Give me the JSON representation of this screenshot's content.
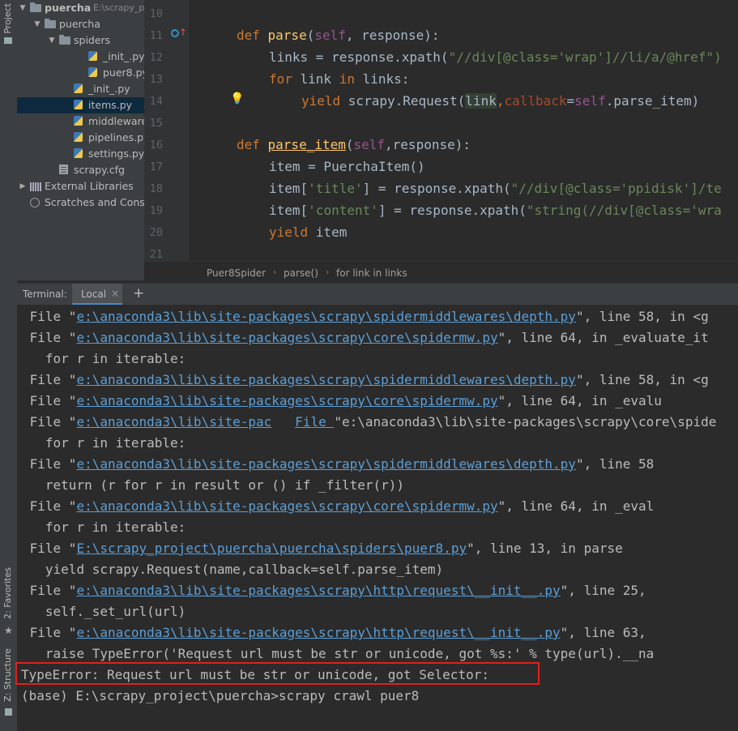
{
  "left_strip": {
    "project_tab": "1: Project",
    "favorites_tab": "2: Favorites",
    "structure_tab": "Z: Structure"
  },
  "tree": [
    {
      "label": "puercha",
      "extra": "E:\\scrapy_p",
      "indent": 0,
      "arrow": "▼",
      "icon": "folder",
      "bold": true
    },
    {
      "label": "puercha",
      "extra": "",
      "indent": 1,
      "arrow": "▼",
      "icon": "folder"
    },
    {
      "label": "spiders",
      "extra": "",
      "indent": 2,
      "arrow": "▼",
      "icon": "folder"
    },
    {
      "label": "_init_.py",
      "extra": "",
      "indent": 4,
      "arrow": "",
      "icon": "py"
    },
    {
      "label": "puer8.py",
      "extra": "",
      "indent": 4,
      "arrow": "",
      "icon": "py"
    },
    {
      "label": "_init_.py",
      "extra": "",
      "indent": 3,
      "arrow": "",
      "icon": "py"
    },
    {
      "label": "items.py",
      "extra": "",
      "indent": 3,
      "arrow": "",
      "icon": "py",
      "selected": true
    },
    {
      "label": "middlewares.p",
      "extra": "",
      "indent": 3,
      "arrow": "",
      "icon": "py"
    },
    {
      "label": "pipelines.py",
      "extra": "",
      "indent": 3,
      "arrow": "",
      "icon": "py"
    },
    {
      "label": "settings.py",
      "extra": "",
      "indent": 3,
      "arrow": "",
      "icon": "py"
    },
    {
      "label": "scrapy.cfg",
      "extra": "",
      "indent": 2,
      "arrow": "",
      "icon": "cfg"
    },
    {
      "label": "External Libraries",
      "extra": "",
      "indent": 0,
      "arrow": "▶",
      "icon": "lib"
    },
    {
      "label": "Scratches and Conso",
      "extra": "",
      "indent": 0,
      "arrow": "",
      "icon": "scratch"
    }
  ],
  "editor": {
    "line_numbers": [
      "10",
      "11",
      "12",
      "13",
      "14",
      "15",
      "16",
      "17",
      "18",
      "19",
      "20",
      "21"
    ],
    "lines": {
      "l11": {
        "def": "def ",
        "name": "parse",
        "open": "(",
        "self": "self",
        "rest": ", response):"
      },
      "l12": {
        "a": "links = response.xpath(",
        "s": "\"//div[@class='wrap']//li/a/@href\")"
      },
      "l13": {
        "kw1": "for ",
        "var": "link ",
        "kw2": "in ",
        "rest": "links:"
      },
      "l14": {
        "kw": "yield ",
        "a": "scrapy.Request(",
        "hl": "link",
        "b": ",",
        "kwarg": "callback",
        "c": "=",
        "self": "self",
        "d": ".parse_item)"
      },
      "l16": {
        "def": "def ",
        "name": "parse_item",
        "open": "(",
        "self": "self",
        "rest": ",response):"
      },
      "l17": {
        "a": "item = PuerchaItem()"
      },
      "l18": {
        "a": "item[",
        "s": "'title'",
        "b": "] = response.xpath(",
        "s2": "\"//div[@class='ppidisk']/te"
      },
      "l19": {
        "a": "item[",
        "s": "'content'",
        "b": "] = response.xpath(",
        "s2": "\"string(//div[@class='wra"
      },
      "l20": {
        "kw": "yield ",
        "a": "item"
      }
    }
  },
  "breadcrumb": [
    "Puer8Spider",
    "parse()",
    "for link in links"
  ],
  "terminal": {
    "title": "Terminal:",
    "tab": "Local",
    "close": "×",
    "add": "+",
    "lines": [
      {
        "pre": "File \"",
        "link": "e:\\anaconda3\\lib\\site-packages\\scrapy\\spidermiddlewares\\depth.py",
        "post": "\", line 58, in <g"
      },
      {
        "pre": "File \"",
        "link": "e:\\anaconda3\\lib\\site-packages\\scrapy\\core\\spidermw.py",
        "post": "\", line 64, in _evaluate_it"
      },
      {
        "pre": "  for r in iterable:",
        "link": "",
        "post": ""
      },
      {
        "pre": "File \"",
        "link": "e:\\anaconda3\\lib\\site-packages\\scrapy\\spidermiddlewares\\depth.py",
        "post": "\", line 58, in <g"
      },
      {
        "pre": "File \"",
        "link": "e:\\anaconda3\\lib\\site-packages\\scrapy\\core\\spidermw.py",
        "post": "\", line 64, in _evalu"
      },
      {
        "pre": "File \"",
        "link": "e:\\anaconda3\\lib\\site-pac",
        "post": "   ",
        "link2": "File ",
        "post2": "\"e:\\anaconda3\\lib\\site-packages\\scrapy\\core\\spide"
      },
      {
        "pre": "  for r in iterable:",
        "link": "",
        "post": ""
      },
      {
        "pre": "File \"",
        "link": "e:\\anaconda3\\lib\\site-packages\\scrapy\\spidermiddlewares\\depth.py",
        "post": "\", line 58"
      },
      {
        "pre": "  return (r for r in result or () if _filter(r))",
        "link": "",
        "post": ""
      },
      {
        "pre": "File \"",
        "link": "e:\\anaconda3\\lib\\site-packages\\scrapy\\core\\spidermw.py",
        "post": "\", line 64, in _eval"
      },
      {
        "pre": "  for r in iterable:",
        "link": "",
        "post": ""
      },
      {
        "pre": "File \"",
        "link": "E:\\scrapy_project\\puercha\\puercha\\spiders\\puer8.py",
        "post": "\", line 13, in parse"
      },
      {
        "pre": "  yield scrapy.Request(name,callback=self.parse_item)",
        "link": "",
        "post": ""
      },
      {
        "pre": "File \"",
        "link": "e:\\anaconda3\\lib\\site-packages\\scrapy\\http\\request\\__init__.py",
        "post": "\", line 25,"
      },
      {
        "pre": "  self._set_url(url)",
        "link": "",
        "post": ""
      },
      {
        "pre": "File \"",
        "link": "e:\\anaconda3\\lib\\site-packages\\scrapy\\http\\request\\__init__.py",
        "post": "\", line 63,"
      },
      {
        "pre": "  raise TypeError('Request url must be str or unicode, got %s:' % type(url).__na",
        "link": "",
        "post": ""
      }
    ],
    "error": "TypeError: Request url must be str or unicode, got Selector:",
    "prompt": "(base) E:\\scrapy_project\\puercha>scrapy crawl puer8"
  }
}
